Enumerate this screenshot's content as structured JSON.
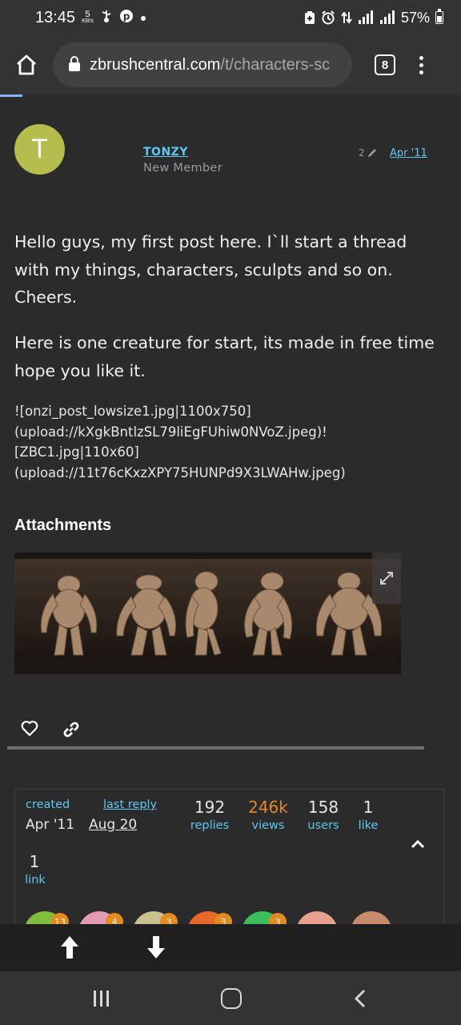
{
  "status_bar": {
    "time": "13:45",
    "speed_value": "5",
    "speed_unit": "KB/s",
    "battery": "57%",
    "left_icons": [
      "usb-icon",
      "pinterest-icon",
      "dot-icon"
    ],
    "right_icons": [
      "battery-saver-icon",
      "alarm-icon",
      "data-arrows-icon",
      "signal-icon",
      "signal-icon"
    ]
  },
  "browser": {
    "url_host": "zbrushcentral.com",
    "url_path": "/t/characters-sc",
    "tab_count": "8",
    "accent_color": "#8ab4f8"
  },
  "post": {
    "avatar_letter": "T",
    "avatar_color": "#b5bd4d",
    "username": "TONZY",
    "user_title": "New Member",
    "edit_count": "2",
    "date": "Apr '11",
    "paragraph_1": "Hello guys, my first post here. I`ll start a thread with my things, characters, sculpts and so on. Cheers.",
    "paragraph_2": "Here is one creature for start, its made in free time hope you like it.",
    "raw_markup": "![onzi_post_lowsize1.jpg|1100x750]\n(upload://kXgkBntlzSL79liEgFUhiw0NVoZ.jpeg)!\n[ZBC1.jpg|110x60]\n(upload://11t76cKxzXPY75HUNPd9X3LWAHw.jpeg)",
    "attachments_heading": "Attachments"
  },
  "topic_map": {
    "created_label": "created",
    "created_date": "Apr '11",
    "last_reply_label": "last reply",
    "last_reply_date": "Aug 20",
    "stats": [
      {
        "value": "192",
        "label": "replies",
        "color": "#e6e6e6"
      },
      {
        "value": "246k",
        "label": "views",
        "color": "#e5862a"
      },
      {
        "value": "158",
        "label": "users",
        "color": "#e6e6e6"
      },
      {
        "value": "1",
        "label": "like",
        "color": "#e6e6e6"
      }
    ],
    "links_value": "1",
    "links_label": "link",
    "participant_badges": [
      "13",
      "4",
      "3",
      "3",
      "3",
      "",
      ""
    ],
    "participant_colors": [
      "#7fbf3f",
      "#e39bb2",
      "#c9c08f",
      "#e8682a",
      "#3bbd5c",
      "#e8a08c",
      "#c58b6c"
    ]
  },
  "colors": {
    "link": "#5ec8f0",
    "background": "#2b2b2b",
    "badge": "#e48a21"
  }
}
